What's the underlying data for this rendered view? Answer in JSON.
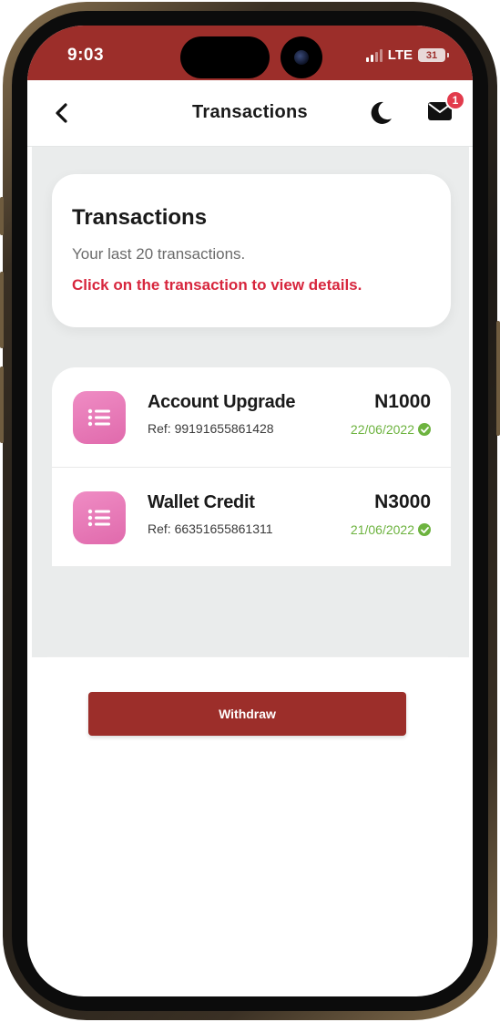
{
  "status_bar": {
    "time": "9:03",
    "network": "LTE",
    "battery": "31"
  },
  "header": {
    "title": "Transactions",
    "notification_count": "1"
  },
  "info_card": {
    "title": "Transactions",
    "subtitle": "Your last 20 transactions.",
    "hint": "Click on the transaction to view details."
  },
  "transactions": [
    {
      "name": "Account Upgrade",
      "ref": "Ref: 99191655861428",
      "amount": "N1000",
      "date": "22/06/2022",
      "status": "completed",
      "icon": "list-icon"
    },
    {
      "name": "Wallet Credit",
      "ref": "Ref: 66351655861311",
      "amount": "N3000",
      "date": "21/06/2022",
      "status": "completed",
      "icon": "list-icon"
    }
  ],
  "actions": {
    "withdraw_label": "Withdraw"
  },
  "colors": {
    "brand": "#9c2e2a",
    "accent_red": "#d7263d",
    "success": "#6db33f",
    "icon_pink": "#e879b6",
    "badge": "#e23b4c"
  },
  "icons": {
    "back": "chevron-left-icon",
    "theme": "moon-icon",
    "mail": "envelope-icon",
    "transaction": "list-icon",
    "status": "check-circle-icon"
  }
}
